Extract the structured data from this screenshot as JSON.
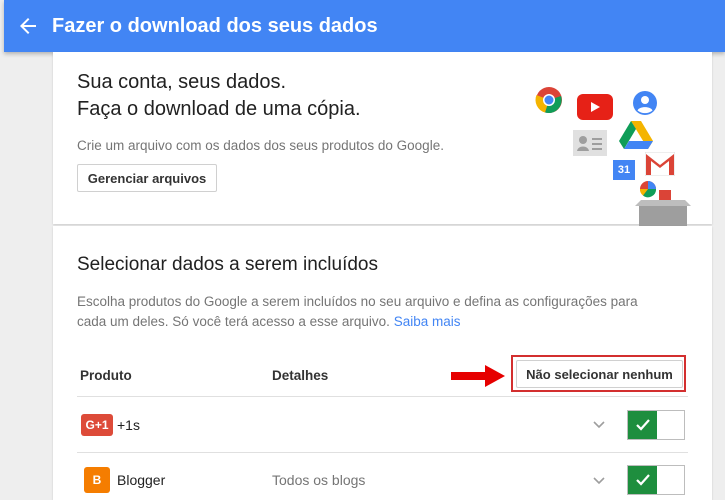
{
  "header": {
    "back_icon": "arrow-left-icon",
    "title": "Fazer o download dos seus dados"
  },
  "hero": {
    "line1": "Sua conta, seus dados.",
    "line2": "Faça o download de uma cópia.",
    "description": "Crie um arquivo com os dados dos seus produtos do Google.",
    "manage_button": "Gerenciar arquivos",
    "icons": [
      "chrome-icon",
      "youtube-icon",
      "profile-icon",
      "contacts-icon",
      "drive-icon",
      "calendar-icon",
      "gmail-icon",
      "pie-chart-icon",
      "box-icon"
    ],
    "calendar_day": "31"
  },
  "select": {
    "title": "Selecionar dados a serem incluídos",
    "desc_line1": "Escolha produtos do Google a serem incluídos no seu arquivo e defina as configurações para",
    "desc_line2": "cada um deles. Só você terá acesso a esse arquivo.",
    "learn_more": "Saiba mais",
    "col_product": "Produto",
    "col_details": "Detalhes",
    "select_none_button": "Não selecionar nenhum"
  },
  "products": [
    {
      "icon": "google-plus-one-icon",
      "icon_text": "G+1",
      "name": "+1s",
      "details": "",
      "enabled": true
    },
    {
      "icon": "blogger-icon",
      "icon_text": "B",
      "name": "Blogger",
      "details": "Todos os blogs",
      "enabled": true
    }
  ],
  "colors": {
    "header": "#4285f4",
    "toggle_on": "#1e8e3e",
    "highlight": "#d32f2f",
    "link": "#4285f4"
  }
}
